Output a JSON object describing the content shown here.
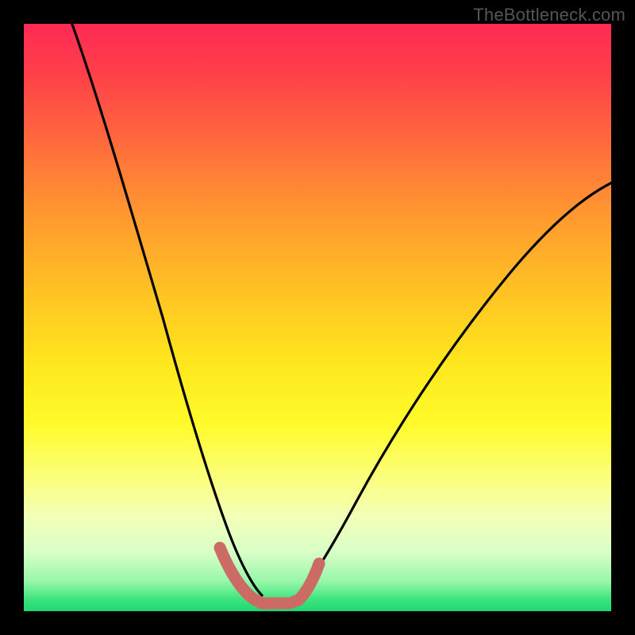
{
  "watermark": "TheBottleneck.com",
  "chart_data": {
    "type": "line",
    "title": "",
    "xlabel": "",
    "ylabel": "",
    "xlim": [
      0,
      100
    ],
    "ylim": [
      0,
      100
    ],
    "series": [
      {
        "name": "left-branch",
        "x": [
          8,
          12,
          16,
          20,
          24,
          27,
          30,
          32,
          34,
          36,
          38,
          40
        ],
        "values": [
          100,
          85,
          70,
          56,
          43,
          32,
          22,
          15,
          9,
          5,
          2,
          1
        ]
      },
      {
        "name": "right-branch",
        "x": [
          46,
          48,
          50,
          54,
          60,
          68,
          76,
          84,
          92,
          100
        ],
        "values": [
          1,
          3,
          6,
          12,
          21,
          33,
          46,
          58,
          67,
          73
        ]
      },
      {
        "name": "valley-highlight",
        "x": [
          33,
          35,
          37,
          39,
          41,
          43,
          44,
          45,
          46,
          47,
          48
        ],
        "values": [
          10,
          6,
          3,
          1.5,
          1,
          1,
          1,
          1.5,
          3,
          5,
          8
        ]
      }
    ],
    "colors": {
      "curve": "#000000",
      "highlight": "#cc6a66",
      "gradient_top": "#ff2a55",
      "gradient_bottom": "#1fd873"
    }
  }
}
